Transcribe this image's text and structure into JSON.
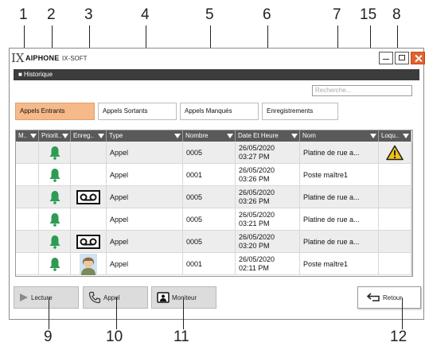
{
  "callouts": {
    "top": [
      "1",
      "2",
      "3",
      "4",
      "5",
      "6",
      "7",
      "15",
      "8"
    ],
    "bottom": [
      "9",
      "10",
      "11",
      "12"
    ]
  },
  "window": {
    "brand": "AIPHONE",
    "product": "IX-SOFT",
    "section_title": "■ Historique"
  },
  "search": {
    "placeholder": "Recherche..."
  },
  "tabs": [
    "Appels Entrants",
    "Appels Sortants",
    "Appels Manqués",
    "Enregistrements"
  ],
  "active_tab": "Appels Entrants",
  "columns": [
    "M..",
    "Priorit..",
    "Enreg..",
    "Type",
    "Nombre",
    "Date Et Heure",
    "Nom",
    "Loqu.."
  ],
  "rows": [
    {
      "priority": "bell-icon",
      "recording": "",
      "type": "Appel",
      "number": "0005",
      "date": "26/05/2020",
      "time": "03:27 PM",
      "name": "Platine de rue a...",
      "alert": "warning-icon"
    },
    {
      "priority": "bell-icon",
      "recording": "",
      "type": "Appel",
      "number": "0001",
      "date": "26/05/2020",
      "time": "03:26 PM",
      "name": "Poste maître1",
      "alert": ""
    },
    {
      "priority": "bell-icon",
      "recording": "tape-icon",
      "type": "Appel",
      "number": "0005",
      "date": "26/05/2020",
      "time": "03:26 PM",
      "name": "Platine de rue a...",
      "alert": ""
    },
    {
      "priority": "bell-icon",
      "recording": "",
      "type": "Appel",
      "number": "0005",
      "date": "26/05/2020",
      "time": "03:21 PM",
      "name": "Platine de rue a...",
      "alert": ""
    },
    {
      "priority": "bell-icon",
      "recording": "tape-icon",
      "type": "Appel",
      "number": "0005",
      "date": "26/05/2020",
      "time": "03:20 PM",
      "name": "Platine de rue a...",
      "alert": ""
    },
    {
      "priority": "bell-icon",
      "recording": "picture-icon",
      "type": "Appel",
      "number": "0001",
      "date": "26/05/2020",
      "time": "02:11 PM",
      "name": "Poste maître1",
      "alert": ""
    }
  ],
  "buttons": {
    "play": "Lecture",
    "call": "Appel",
    "monitor": "Moniteur",
    "back": "Retour"
  },
  "colors": {
    "bell": "#2e9b55",
    "active_tab": "#f5b98a",
    "header": "#5a5a5a",
    "close": "#e2622e",
    "warning": "#f2c21b"
  }
}
